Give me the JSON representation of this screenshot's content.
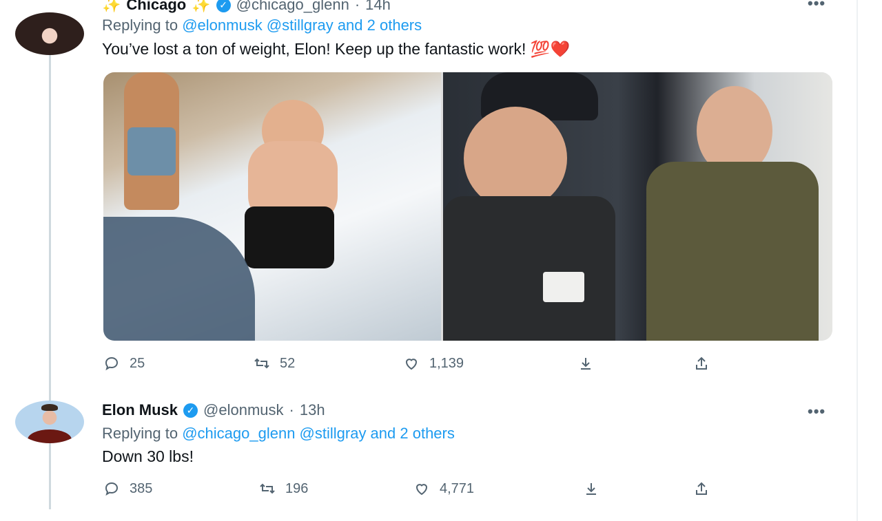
{
  "tweets": [
    {
      "name": "Chicago",
      "handle": "@chicago_glenn",
      "time": "14h",
      "replying_prefix": "Replying to",
      "mentions": "@elonmusk @stillgray and 2 others",
      "text": "You’ve lost a ton of weight, Elon! Keep up the fantastic work! 💯❤️",
      "stats": {
        "replies": "25",
        "retweets": "52",
        "likes": "1,139"
      }
    },
    {
      "name": "Elon Musk",
      "handle": "@elonmusk",
      "time": "13h",
      "replying_prefix": "Replying to",
      "mentions": "@chicago_glenn @stillgray and 2 others",
      "text": "Down 30 lbs!",
      "stats": {
        "replies": "385",
        "retweets": "196",
        "likes": "4,771"
      }
    }
  ],
  "icons": [
    "reply-icon",
    "retweet-icon",
    "like-icon",
    "download-icon",
    "share-icon",
    "more-icon",
    "verified-icon"
  ],
  "colors": {
    "accent": "#1d9bf0",
    "muted": "#536471",
    "text": "#0f1419"
  }
}
